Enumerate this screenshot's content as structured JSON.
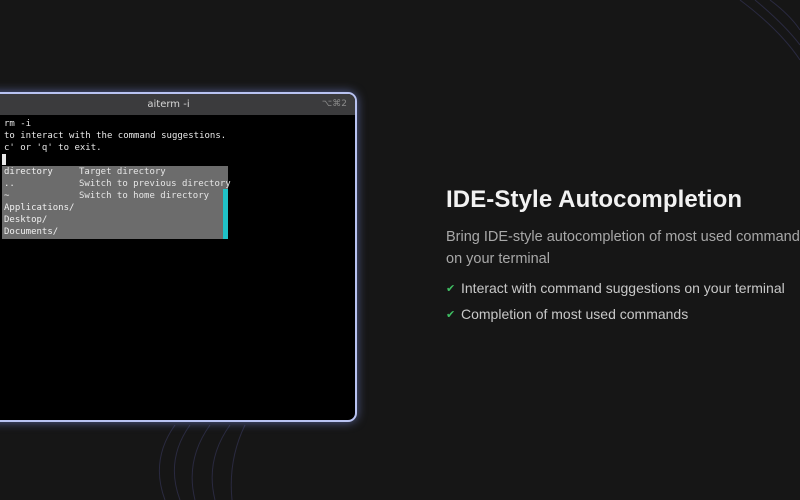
{
  "terminal": {
    "title": "aiterm -i",
    "shortcut": "⌥⌘2",
    "lines": [
      "rm -i",
      "to interact with the command suggestions.",
      "c' or 'q' to exit."
    ],
    "suggestions": [
      {
        "value": "directory",
        "desc": "Target directory"
      },
      {
        "value": "..",
        "desc": "Switch to previous directory"
      },
      {
        "value": "~",
        "desc": "Switch to home directory"
      },
      {
        "value": "Applications/",
        "desc": ""
      },
      {
        "value": "Desktop/",
        "desc": ""
      },
      {
        "value": "Documents/",
        "desc": ""
      }
    ],
    "accent": "#1fc1c7"
  },
  "feature": {
    "title": "IDE-Style Autocompletion",
    "subtitle_line1": "Bring IDE-style autocompletion of most used commands",
    "subtitle_line2": "on your terminal",
    "bullets": [
      "Interact with command suggestions on your terminal",
      "Completion of most used commands"
    ],
    "check_icon": "check-icon",
    "check_color": "#3fbf63"
  }
}
